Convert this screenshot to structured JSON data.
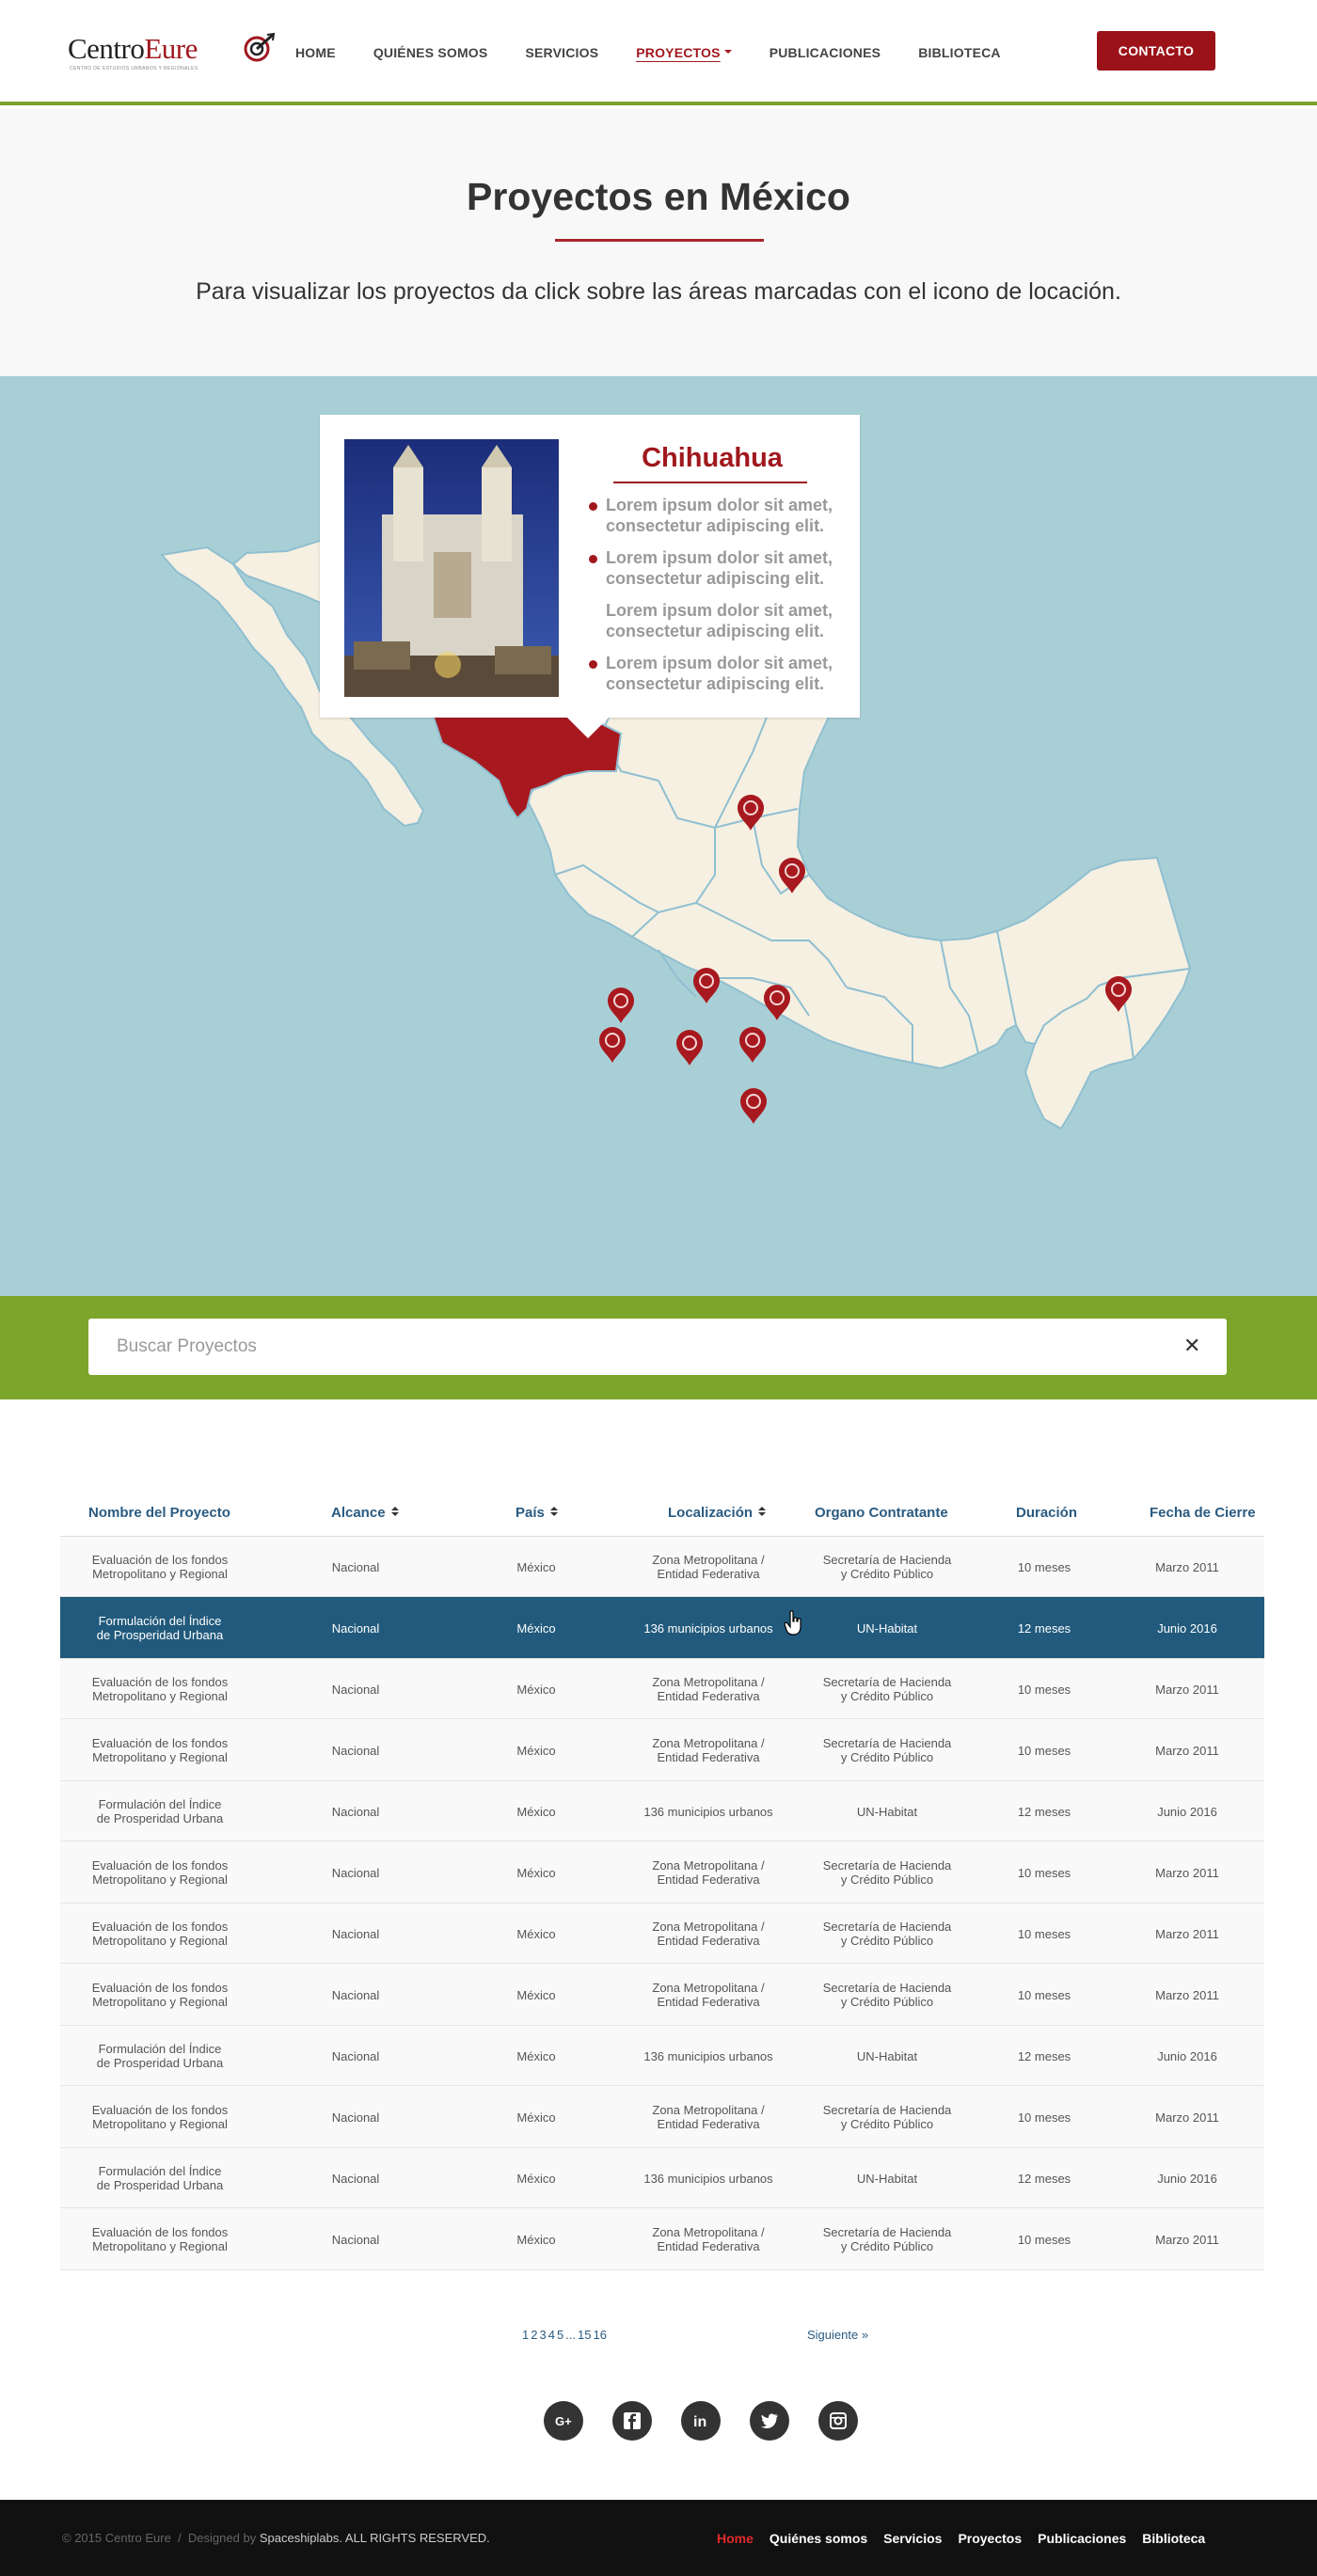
{
  "header": {
    "logo": {
      "text_part1": "Centro",
      "text_part2": "Eure",
      "tagline": "CENTRO DE ESTUDIOS URBANOS Y REGIONALES"
    },
    "nav": [
      {
        "label": "Home",
        "active": false
      },
      {
        "label": "Quiénes somos",
        "active": false
      },
      {
        "label": "Servicios",
        "active": false
      },
      {
        "label": "Proyectos",
        "active": true,
        "dropdown": true
      },
      {
        "label": "Publicaciones",
        "active": false
      },
      {
        "label": "Biblioteca",
        "active": false
      }
    ],
    "contact_label": "Contacto"
  },
  "intro": {
    "title": "Proyectos en México",
    "subtitle": "Para visualizar  los proyectos da click sobre las áreas marcadas con el icono de locación."
  },
  "map": {
    "popup": {
      "title": "Chihuahua",
      "items": [
        {
          "text": "Lorem ipsum dolor sit amet, consectetur adipiscing elit.",
          "bullet": true
        },
        {
          "text": "Lorem ipsum dolor sit amet, consectetur adipiscing elit.",
          "bullet": true
        },
        {
          "text": "Lorem ipsum dolor sit amet, consectetur adipiscing elit.",
          "bullet": false
        },
        {
          "text": "Lorem ipsum dolor sit amet, consectetur adipiscing elit.",
          "bullet": true
        }
      ]
    },
    "colors": {
      "water": "#a9cfd6",
      "land": "#f5f0e2",
      "border": "#8fbfd0",
      "highlight": "#a8191f",
      "marker": "#a8191f"
    }
  },
  "search": {
    "placeholder": "Buscar Proyectos",
    "value": ""
  },
  "table": {
    "columns": [
      {
        "label": "Nombre del Proyecto",
        "sortable": false
      },
      {
        "label": "Alcance",
        "sortable": true
      },
      {
        "label": "País",
        "sortable": true
      },
      {
        "label": "Localización",
        "sortable": true
      },
      {
        "label": "Organo Contratante",
        "sortable": false
      },
      {
        "label": "Duración",
        "sortable": false
      },
      {
        "label": "Fecha de Cierre",
        "sortable": false
      }
    ],
    "rows": [
      {
        "nombre": [
          "Evaluación de los fondos",
          "Metropolitano y Regional"
        ],
        "alcance": "Nacional",
        "pais": "México",
        "localizacion": [
          "Zona Metropolitana /",
          "Entidad Federativa"
        ],
        "organo": [
          "Secretaría de Hacienda",
          "y Crédito Público"
        ],
        "duracion": "10 meses",
        "cierre": "Marzo 2011"
      },
      {
        "nombre": [
          "Formulación del Índice",
          "de Prosperidad Urbana"
        ],
        "alcance": "Nacional",
        "pais": "México",
        "localizacion": [
          "136 municipios urbanos"
        ],
        "organo": [
          "UN-Habitat"
        ],
        "duracion": "12 meses",
        "cierre": "Junio 2016",
        "highlighted": true
      },
      {
        "nombre": [
          "Evaluación de los fondos",
          "Metropolitano y Regional"
        ],
        "alcance": "Nacional",
        "pais": "México",
        "localizacion": [
          "Zona Metropolitana /",
          "Entidad Federativa"
        ],
        "organo": [
          "Secretaría de Hacienda",
          "y Crédito Público"
        ],
        "duracion": "10 meses",
        "cierre": "Marzo 2011"
      },
      {
        "nombre": [
          "Evaluación de los fondos",
          "Metropolitano y Regional"
        ],
        "alcance": "Nacional",
        "pais": "México",
        "localizacion": [
          "Zona Metropolitana /",
          "Entidad Federativa"
        ],
        "organo": [
          "Secretaría de Hacienda",
          "y Crédito Público"
        ],
        "duracion": "10 meses",
        "cierre": "Marzo 2011"
      },
      {
        "nombre": [
          "Formulación del Índice",
          "de Prosperidad Urbana"
        ],
        "alcance": "Nacional",
        "pais": "México",
        "localizacion": [
          "136 municipios urbanos"
        ],
        "organo": [
          "UN-Habitat"
        ],
        "duracion": "12 meses",
        "cierre": "Junio 2016"
      },
      {
        "nombre": [
          "Evaluación de los fondos",
          "Metropolitano y Regional"
        ],
        "alcance": "Nacional",
        "pais": "México",
        "localizacion": [
          "Zona Metropolitana /",
          "Entidad Federativa"
        ],
        "organo": [
          "Secretaría de Hacienda",
          "y Crédito Público"
        ],
        "duracion": "10 meses",
        "cierre": "Marzo 2011"
      },
      {
        "nombre": [
          "Evaluación de los fondos",
          "Metropolitano y Regional"
        ],
        "alcance": "Nacional",
        "pais": "México",
        "localizacion": [
          "Zona Metropolitana /",
          "Entidad Federativa"
        ],
        "organo": [
          "Secretaría de Hacienda",
          "y Crédito Público"
        ],
        "duracion": "10 meses",
        "cierre": "Marzo 2011"
      },
      {
        "nombre": [
          "Evaluación de los fondos",
          "Metropolitano y Regional"
        ],
        "alcance": "Nacional",
        "pais": "México",
        "localizacion": [
          "Zona Metropolitana /",
          "Entidad Federativa"
        ],
        "organo": [
          "Secretaría de Hacienda",
          "y Crédito Público"
        ],
        "duracion": "10 meses",
        "cierre": "Marzo 2011"
      },
      {
        "nombre": [
          "Formulación del Índice",
          "de Prosperidad Urbana"
        ],
        "alcance": "Nacional",
        "pais": "México",
        "localizacion": [
          "136 municipios urbanos"
        ],
        "organo": [
          "UN-Habitat"
        ],
        "duracion": "12 meses",
        "cierre": "Junio 2016"
      },
      {
        "nombre": [
          "Evaluación de los fondos",
          "Metropolitano y Regional"
        ],
        "alcance": "Nacional",
        "pais": "México",
        "localizacion": [
          "Zona Metropolitana /",
          "Entidad Federativa"
        ],
        "organo": [
          "Secretaría de Hacienda",
          "y Crédito Público"
        ],
        "duracion": "10 meses",
        "cierre": "Marzo 2011"
      },
      {
        "nombre": [
          "Formulación del Índice",
          "de Prosperidad Urbana"
        ],
        "alcance": "Nacional",
        "pais": "México",
        "localizacion": [
          "136 municipios urbanos"
        ],
        "organo": [
          "UN-Habitat"
        ],
        "duracion": "12 meses",
        "cierre": "Junio 2016"
      },
      {
        "nombre": [
          "Evaluación de los fondos",
          "Metropolitano y Regional"
        ],
        "alcance": "Nacional",
        "pais": "México",
        "localizacion": [
          "Zona Metropolitana /",
          "Entidad Federativa"
        ],
        "organo": [
          "Secretaría de Hacienda",
          "y Crédito Público"
        ],
        "duracion": "10 meses",
        "cierre": "Marzo 2011"
      }
    ]
  },
  "pagination": {
    "pages": [
      "1",
      "2",
      "3",
      "4",
      "5",
      "...",
      "15",
      "16"
    ],
    "next_label": "Siguiente »"
  },
  "social": [
    "google-plus-icon",
    "facebook-icon",
    "linkedin-icon",
    "twitter-icon",
    "instagram-icon"
  ],
  "footer": {
    "copyright": "© 2015 Centro Eure",
    "separator": "/",
    "designed_by": "Designed by",
    "designer": "Spaceshiplabs. ALL RIGHTS RESERVED.",
    "nav": [
      {
        "label": "Home",
        "active": true
      },
      {
        "label": "Quiénes somos",
        "active": false
      },
      {
        "label": "Servicios",
        "active": false
      },
      {
        "label": "Proyectos",
        "active": false
      },
      {
        "label": "Publicaciones",
        "active": false
      },
      {
        "label": "Biblioteca",
        "active": false
      }
    ]
  }
}
